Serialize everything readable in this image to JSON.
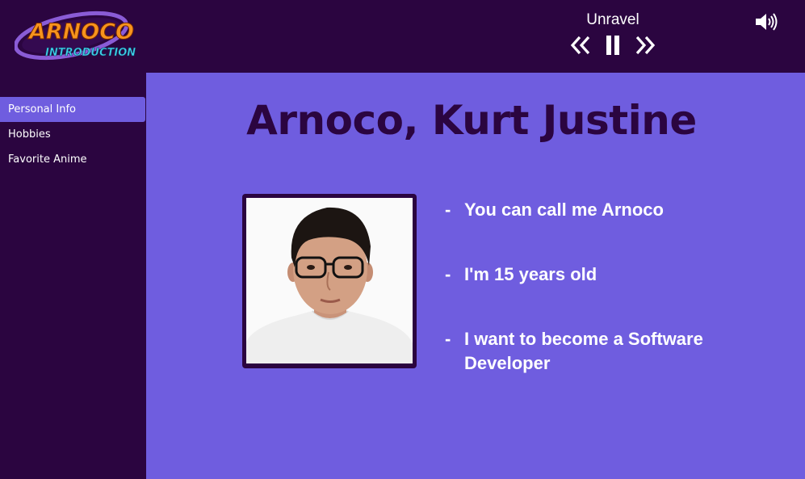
{
  "logo": {
    "line1": "ARNOCO",
    "line2": "INTRODUCTION"
  },
  "player": {
    "song_title": "Unravel",
    "icons": [
      "rewind-icon",
      "pause-icon",
      "fast-forward-icon"
    ]
  },
  "volume": {
    "icon": "speaker-icon"
  },
  "sidebar": {
    "items": [
      {
        "label": "Personal Info",
        "active": true
      },
      {
        "label": "Hobbies",
        "active": false
      },
      {
        "label": "Favorite Anime",
        "active": false
      }
    ]
  },
  "main": {
    "title": "Arnoco, Kurt Justine",
    "facts": [
      {
        "dash": "-",
        "text": "You can call me Arnoco"
      },
      {
        "dash": "-",
        "text": "I'm 15 years old"
      },
      {
        "dash": "-",
        "text": "I want to become a Software Developer"
      }
    ]
  },
  "colors": {
    "background": "#2b0540",
    "panel": "#6f5ddf",
    "title": "#2b0540",
    "logo_orange": "#f7941d",
    "logo_cyan": "#3fd0e8"
  }
}
